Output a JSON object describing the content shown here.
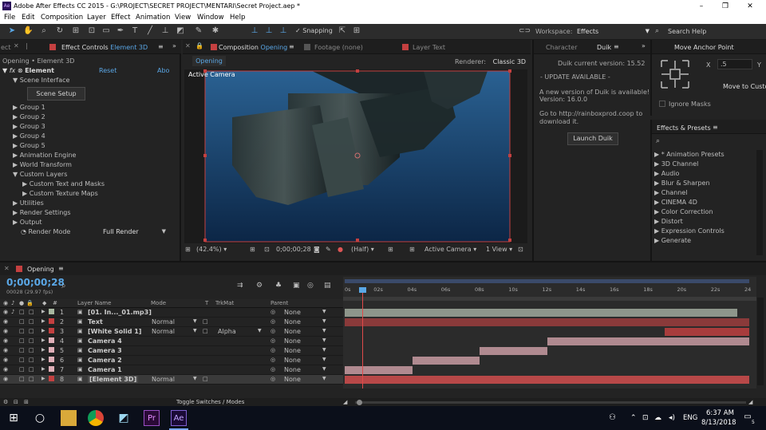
{
  "window": {
    "title": "Adobe After Effects CC 2015 - G:\\PROJECT\\SECRET PROJECT\\MENTARI\\Secret Project.aep *",
    "logo": "Ae"
  },
  "menu": [
    "File",
    "Edit",
    "Composition",
    "Layer",
    "Effect",
    "Animation",
    "View",
    "Window",
    "Help"
  ],
  "toolbar": {
    "snapping": "Snapping",
    "workspace_label": "Workspace:",
    "workspace_value": "Effects",
    "search_help": "Search Help"
  },
  "effect_controls": {
    "tab_prefix": "ect",
    "title": "Effect Controls",
    "layer": "Element 3D",
    "breadcrumb": "Opening • Element 3D",
    "fx_name": "Element",
    "reset": "Reset",
    "about": "Abo",
    "scene_interface": "Scene Interface",
    "scene_setup": "Scene Setup",
    "groups": [
      "Group 1",
      "Group 2",
      "Group 3",
      "Group 4",
      "Group 5"
    ],
    "items": [
      "Animation Engine",
      "World Transform",
      "Custom Layers"
    ],
    "custom_sub": [
      "Custom Text and Masks",
      "Custom Texture Maps"
    ],
    "items2": [
      "Utilities",
      "Render Settings",
      "Output"
    ],
    "render_mode_label": "Render Mode",
    "render_mode_value": "Full Render"
  },
  "composition": {
    "tab_title": "Composition",
    "comp_name": "Opening",
    "footage": "Footage (none)",
    "layer_text": "Layer Text",
    "sub_tab": "Opening",
    "renderer_label": "Renderer:",
    "renderer_value": "Classic 3D",
    "active_camera_label": "Active Camera",
    "zoom": "(42.4%)",
    "timecode": "0;00;00;28",
    "resolution": "(Half)",
    "camera": "Active Camera",
    "view": "1 View"
  },
  "duik": {
    "tab_character": "Character",
    "tab_duik": "Duik",
    "version": "Duik current version: 15.52",
    "update": "- UPDATE AVAILABLE -",
    "msg1": "A new version of Duik is available!",
    "msg2": "Version: 16.0.0",
    "msg3": "Go to http://rainboxprod.coop to",
    "msg4": "download it.",
    "launch": "Launch Duik"
  },
  "anchor": {
    "title": "Move Anchor Point",
    "x_label": "X",
    "x_value": ".5",
    "y_label": "Y",
    "move_to": "Move to Custo",
    "ignore_masks": "Ignore Masks"
  },
  "effects_presets": {
    "title": "Effects & Presets",
    "search_placeholder": "",
    "items": [
      "* Animation Presets",
      "3D Channel",
      "Audio",
      "Blur & Sharpen",
      "Channel",
      "CINEMA 4D",
      "Color Correction",
      "Distort",
      "Expression Controls",
      "Generate"
    ]
  },
  "timeline": {
    "tab": "Opening",
    "timecode": "0;00;00;28",
    "frames": "00028 (29.97 fps)",
    "search_placeholder": "",
    "col_layer_name": "Layer Name",
    "col_mode": "Mode",
    "col_t": "T",
    "col_trkmat": "TrkMat",
    "col_parent": "Parent",
    "ruler": [
      "0s",
      "02s",
      "04s",
      "06s",
      "08s",
      "10s",
      "12s",
      "14s",
      "16s",
      "18s",
      "20s",
      "22s",
      "24"
    ],
    "layers": [
      {
        "num": "1",
        "name": "[01. In..._01.mp3]",
        "mode": "",
        "trkmat": "",
        "parent": "None",
        "color": "#a8b8a0",
        "bar_color": "#8e968b"
      },
      {
        "num": "2",
        "name": "Text",
        "mode": "Normal",
        "trkmat": "",
        "parent": "None",
        "color": "#c44040",
        "bar_color": "#8a3a3a"
      },
      {
        "num": "3",
        "name": "[White Solid 1]",
        "mode": "Normal",
        "trkmat": "Alpha",
        "parent": "None",
        "color": "#c44040",
        "bar_color": "#a83c3c"
      },
      {
        "num": "4",
        "name": "Camera 4",
        "mode": "",
        "trkmat": "",
        "parent": "None",
        "color": "#e0b0b8",
        "bar_color": "#b08a90"
      },
      {
        "num": "5",
        "name": "Camera 3",
        "mode": "",
        "trkmat": "",
        "parent": "None",
        "color": "#e0b0b8",
        "bar_color": "#b08a90"
      },
      {
        "num": "6",
        "name": "Camera 2",
        "mode": "",
        "trkmat": "",
        "parent": "None",
        "color": "#e0b0b8",
        "bar_color": "#b08a90"
      },
      {
        "num": "7",
        "name": "Camera 1",
        "mode": "",
        "trkmat": "",
        "parent": "None",
        "color": "#e0b0b8",
        "bar_color": "#b08a90"
      },
      {
        "num": "8",
        "name": "[Element 3D]",
        "mode": "Normal",
        "trkmat": "",
        "parent": "None",
        "color": "#c44040",
        "bar_color": "#b84848"
      }
    ],
    "toggle": "Toggle Switches / Modes"
  },
  "taskbar": {
    "lang": "ENG",
    "time": "6:37 AM",
    "date": "8/13/2018",
    "notif": "5",
    "app_pr": "Pr",
    "app_ae": "Ae"
  }
}
